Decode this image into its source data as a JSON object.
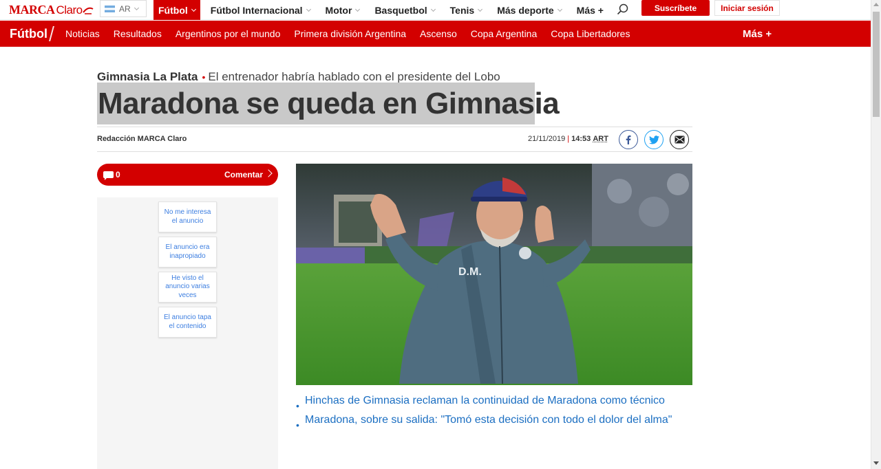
{
  "topbar": {
    "logo": {
      "marca": "MARCA",
      "claro": "Claro"
    },
    "country": "AR",
    "nav": [
      {
        "label": "Fútbol",
        "active": true,
        "dropdown": true
      },
      {
        "label": "Fútbol Internacional",
        "active": false,
        "dropdown": true
      },
      {
        "label": "Motor",
        "active": false,
        "dropdown": true
      },
      {
        "label": "Basquetbol",
        "active": false,
        "dropdown": true
      },
      {
        "label": "Tenis",
        "active": false,
        "dropdown": true
      },
      {
        "label": "Más deporte",
        "active": false,
        "dropdown": true
      },
      {
        "label": "Más +",
        "active": false,
        "dropdown": false
      }
    ],
    "subscribe_label": "Suscríbete",
    "login_label": "Iniciar sesión"
  },
  "section": {
    "title": "Fútbol",
    "links": [
      "Noticias",
      "Resultados",
      "Argentinos por el mundo",
      "Primera división Argentina",
      "Ascenso",
      "Copa Argentina",
      "Copa Libertadores"
    ],
    "more": "Más +"
  },
  "article": {
    "kicker_tag": "Gimnasia La Plata",
    "kicker_text": "El entrenador habría hablado con el presidente del Lobo",
    "headline": "Maradona se queda en Gimnasia",
    "author": "Redacción MARCA Claro",
    "date": "21/11/2019",
    "time": "14:53",
    "timezone": "ART",
    "comments": {
      "count": "0",
      "label": "Comentar"
    },
    "related": [
      "Hinchas de Gimnasia reclaman la continuidad de Maradona como técnico",
      "Maradona, sobre su salida: \"Tomó esta decisión con todo el dolor del alma\""
    ]
  },
  "ad_feedback": [
    "No me interesa el anuncio",
    "El anuncio era inapropiado",
    "He visto el anuncio varias veces",
    "El anuncio tapa el contenido"
  ],
  "photo": {
    "jacket_text": "D.M."
  },
  "colors": {
    "brand_red": "#d30000",
    "link_blue": "#1c6fc2",
    "facebook": "#3b5998",
    "twitter": "#1da1f2"
  },
  "icons": [
    "search-icon",
    "facebook-icon",
    "twitter-icon",
    "email-icon",
    "comment-icon",
    "chevron-right-icon"
  ]
}
